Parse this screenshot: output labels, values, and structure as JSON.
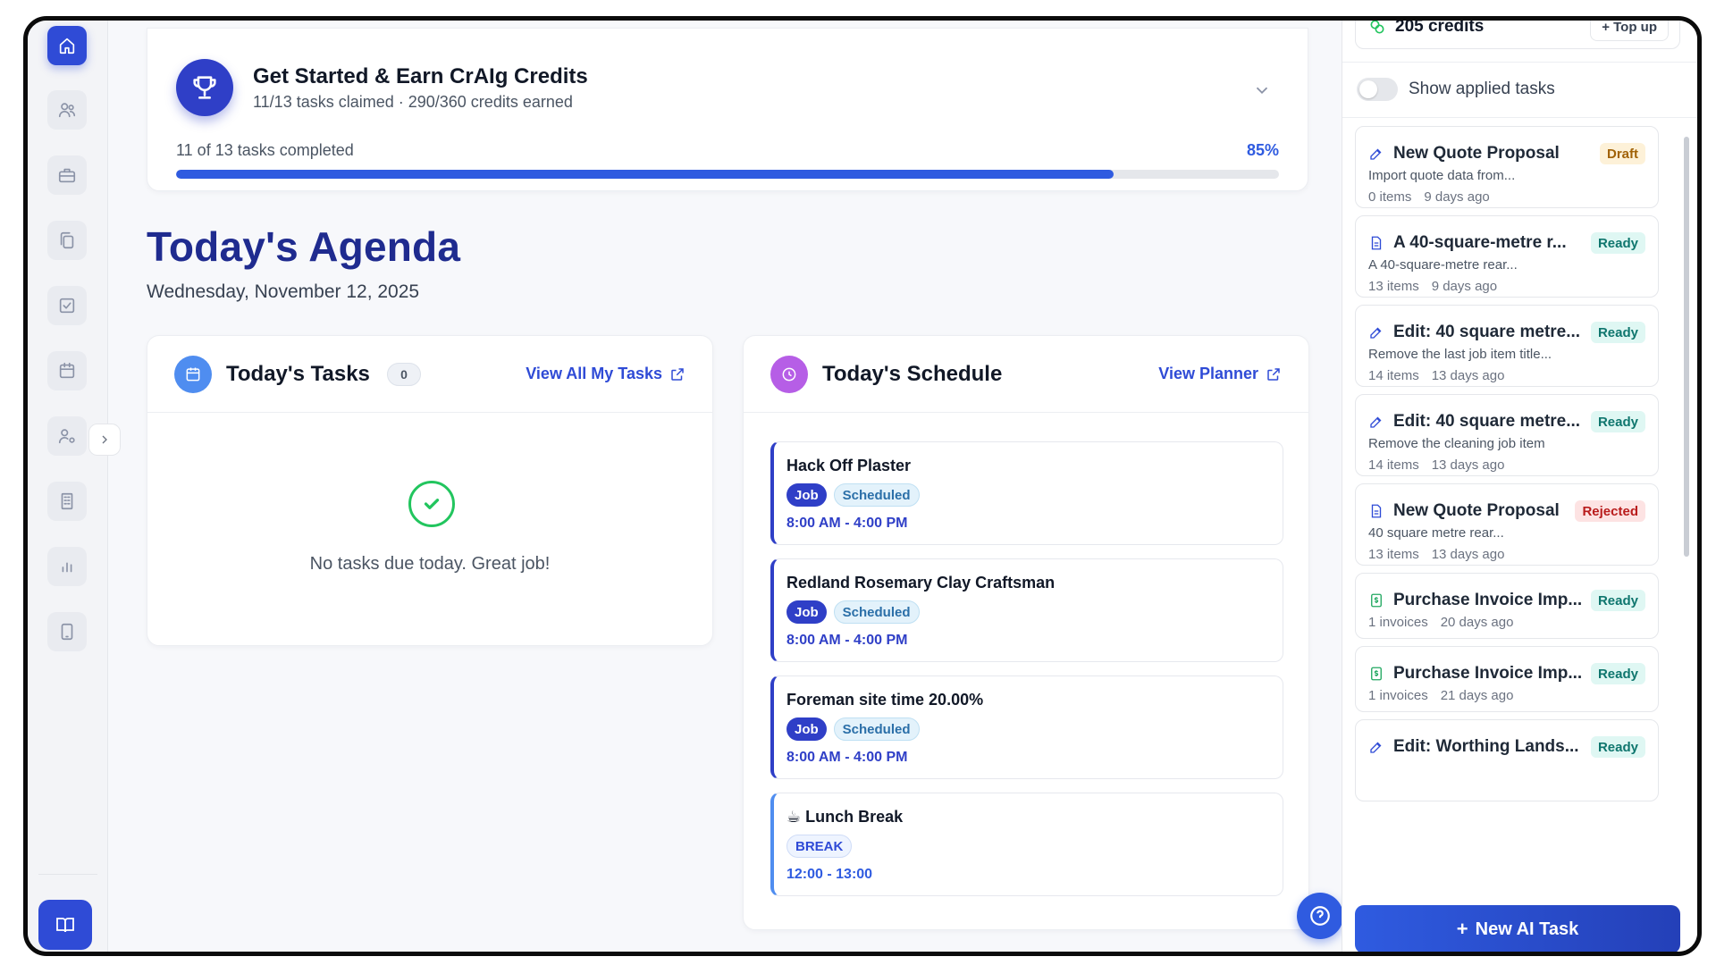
{
  "credits_card": {
    "title": "Get Started & Earn CrAIg Credits",
    "subtitle": "11/13 tasks claimed · 290/360 credits earned",
    "progress_label": "11 of 13 tasks completed",
    "progress_percent_label": "85%",
    "progress_fraction": 0.85
  },
  "agenda": {
    "title": "Today's Agenda",
    "date": "Wednesday, November 12, 2025"
  },
  "tasks_panel": {
    "title": "Today's Tasks",
    "count": "0",
    "link": "View All My Tasks",
    "empty_message": "No tasks due today. Great job!"
  },
  "schedule_panel": {
    "title": "Today's Schedule",
    "link": "View Planner",
    "events": [
      {
        "title": "Hack Off Plaster",
        "type": "Job",
        "status": "Scheduled",
        "time": "8:00 AM - 4:00 PM"
      },
      {
        "title": "Redland Rosemary Clay Craftsman",
        "type": "Job",
        "status": "Scheduled",
        "time": "8:00 AM - 4:00 PM"
      },
      {
        "title": "Foreman site time 20.00%",
        "type": "Job",
        "status": "Scheduled",
        "time": "8:00 AM - 4:00 PM"
      },
      {
        "title": "☕ Lunch Break",
        "type": "BREAK",
        "status": "",
        "time": "12:00 - 13:00"
      }
    ]
  },
  "right_panel": {
    "credits": "205 credits",
    "top_up": "+ Top up",
    "toggle_label": "Show applied tasks",
    "new_task_button": "New AI Task",
    "new_task_plus": "+",
    "tasks": [
      {
        "icon": "edit-icon",
        "title": "New Quote Proposal",
        "status": "Draft",
        "desc": "Import quote data from...",
        "count": "0 items",
        "age": "9 days ago"
      },
      {
        "icon": "document-icon",
        "title": "A 40-square-metre r...",
        "status": "Ready",
        "desc": "A 40-square-metre rear...",
        "count": "13 items",
        "age": "9 days ago"
      },
      {
        "icon": "edit-icon",
        "title": "Edit: 40 square metre...",
        "status": "Ready",
        "desc": "Remove the last job item title...",
        "count": "14 items",
        "age": "13 days ago"
      },
      {
        "icon": "edit-icon",
        "title": "Edit: 40 square metre...",
        "status": "Ready",
        "desc": "Remove the cleaning job item",
        "count": "14 items",
        "age": "13 days ago"
      },
      {
        "icon": "document-icon",
        "title": "New Quote Proposal",
        "status": "Rejected",
        "desc": "40 square metre rear...",
        "count": "13 items",
        "age": "13 days ago"
      },
      {
        "icon": "money-icon",
        "title": "Purchase Invoice Imp...",
        "status": "Ready",
        "desc": "",
        "count": "1 invoices",
        "age": "20 days ago"
      },
      {
        "icon": "money-icon",
        "title": "Purchase Invoice Imp...",
        "status": "Ready",
        "desc": "",
        "count": "1 invoices",
        "age": "21 days ago"
      },
      {
        "icon": "edit-icon",
        "title": "Edit: Worthing Lands...",
        "status": "Ready",
        "desc": "",
        "count": "",
        "age": ""
      }
    ]
  },
  "colors": {
    "accent": "#2f4bd6",
    "agenda_title": "#1f2b8f",
    "success": "#22c55e"
  }
}
